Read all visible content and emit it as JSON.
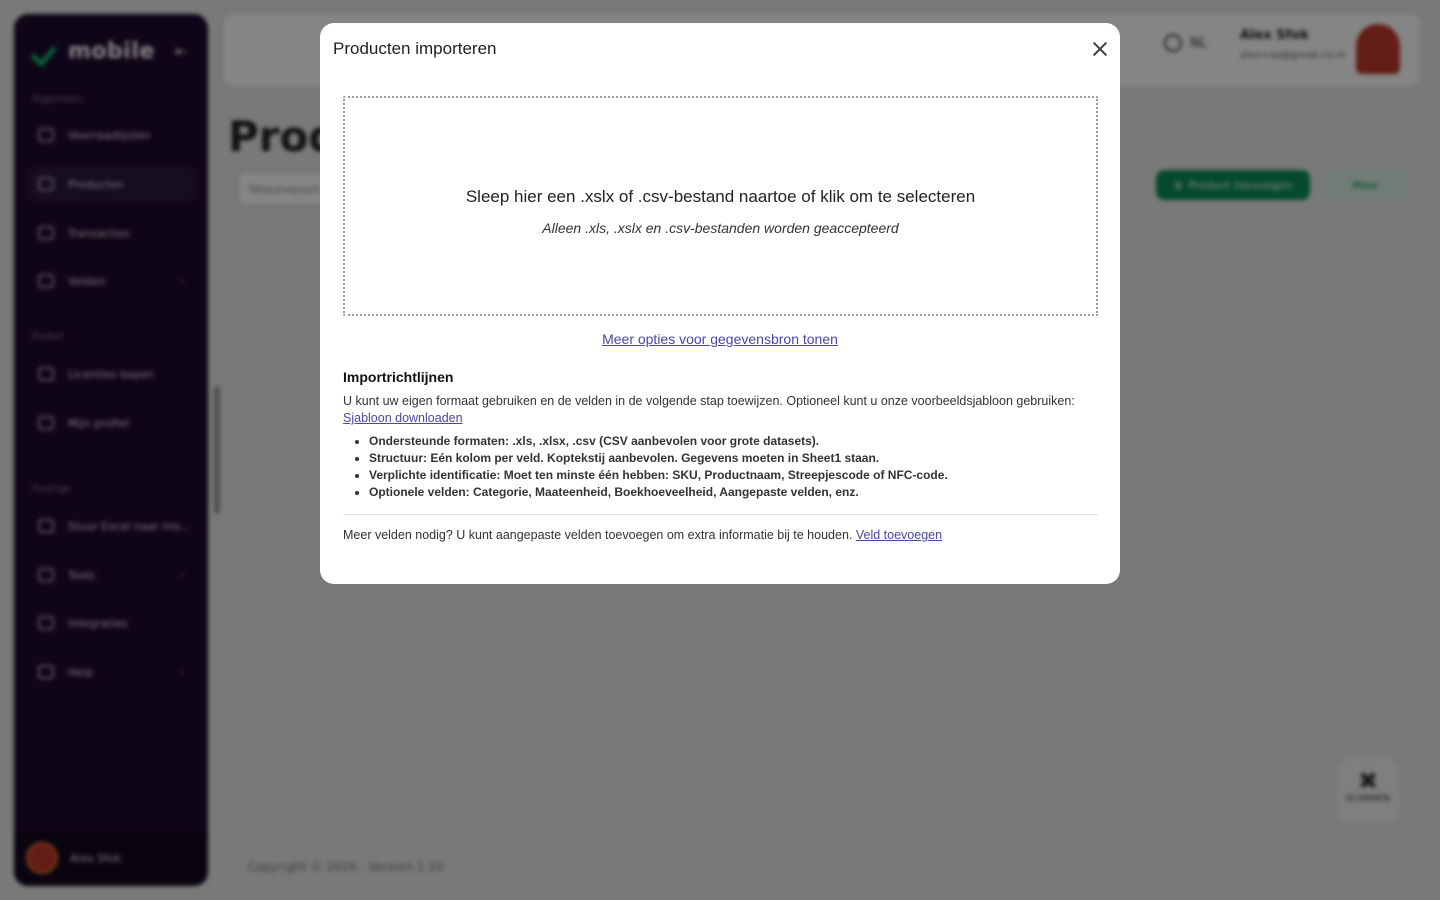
{
  "app": {
    "logo_text": "mobile",
    "sidebar": {
      "section_1": "Algemeen",
      "items_1": [
        {
          "label": "Voorraadlijsten",
          "icon": "list-icon"
        },
        {
          "label": "Producten",
          "icon": "box-icon",
          "active": true
        },
        {
          "label": "Transacties",
          "icon": "transfer-icon"
        },
        {
          "label": "Velden",
          "icon": "fields-icon",
          "chevron": true
        }
      ],
      "section_2": "Profiel",
      "items_2": [
        {
          "label": "Licenties kopen",
          "icon": "license-icon"
        },
        {
          "label": "Mijn profiel",
          "icon": "user-icon"
        }
      ],
      "section_3": "Overige",
      "items_3": [
        {
          "label": "Stuur Excel naar mo...",
          "icon": "upload-icon"
        },
        {
          "label": "Tools",
          "icon": "tools-icon",
          "chevron": true
        },
        {
          "label": "Integraties",
          "icon": "integrations-icon"
        },
        {
          "label": "Help",
          "icon": "help-icon",
          "chevron": true
        }
      ],
      "user_name": "Alex Sfok"
    },
    "topbar": {
      "language": "NL",
      "user_name": "Alex Sfok",
      "user_email": "alex+sa@gmail.co.nl"
    },
    "page_title": "Prod",
    "search_placeholder": "Webshopvelt",
    "new_product_button": "Product toevoegen",
    "more_button": "Meer",
    "footer": "Copyright © 2026 - Versien 1.10",
    "scanner_label": "SCANNEN"
  },
  "modal": {
    "title": "Producten importeren",
    "dropzone_main": "Sleep hier een .xslx of .csv-bestand naartoe of klik om te selecteren",
    "dropzone_sub": "Alleen .xls, .xslx en .csv-bestanden worden geaccepteerd",
    "more_options_link": "Meer opties voor gegevensbron tonen",
    "guidelines_title": "Importrichtlijnen",
    "guidelines_text": "U kunt uw eigen formaat gebruiken en de velden in de volgende stap toewijzen. Optioneel kunt u onze voorbeeldsjabloon gebruiken:",
    "template_link": "Sjabloon downloaden",
    "guidelines": [
      "Ondersteunde formaten: .xls, .xlsx, .csv (CSV aanbevolen voor grote datasets).",
      "Structuur: Eén kolom per veld. Koptekstij aanbevolen. Gegevens moeten in Sheet1 staan.",
      "Verplichte identificatie: Moet ten minste één hebben: SKU, Productnaam, Streepjescode of NFC-code.",
      "Optionele velden: Categorie, Maateenheid, Boekhoeveelheid, Aangepaste velden, enz."
    ],
    "footer_text": "Meer velden nodig? U kunt aangepaste velden toevoegen om extra informatie bij te houden.",
    "add_field_link": "Veld toevoegen"
  }
}
